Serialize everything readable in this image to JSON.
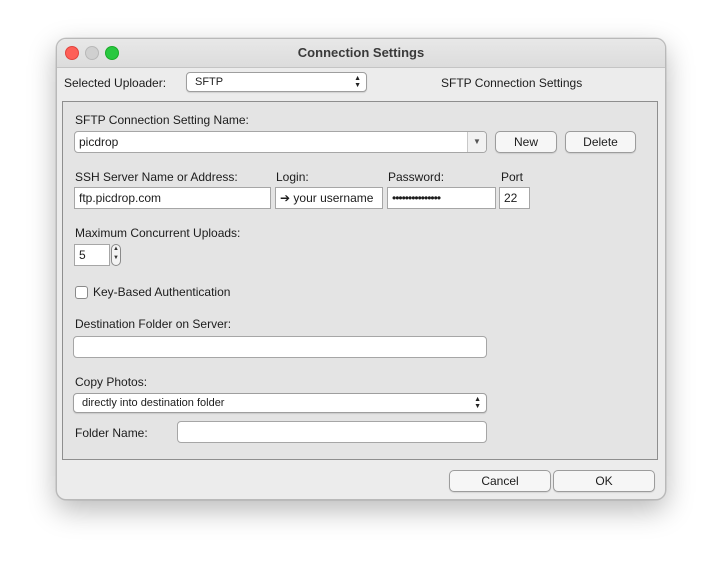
{
  "window": {
    "title": "Connection Settings"
  },
  "header": {
    "selected_uploader_label": "Selected Uploader:",
    "selected_uploader_value": "SFTP",
    "panel_title": "SFTP Connection Settings"
  },
  "connection": {
    "name_label": "SFTP Connection Setting Name:",
    "name_value": "picdrop",
    "new_label": "New",
    "delete_label": "Delete"
  },
  "server": {
    "server_label": "SSH Server Name or Address:",
    "server_value": "ftp.picdrop.com",
    "login_label": "Login:",
    "login_value": "➔ your username",
    "password_label": "Password:",
    "password_value": "•••••••••••••••",
    "port_label": "Port",
    "port_value": "22"
  },
  "uploads": {
    "max_label": "Maximum Concurrent Uploads:",
    "max_value": "5"
  },
  "auth": {
    "key_based_label": "Key-Based Authentication",
    "key_based_checked": false
  },
  "destination": {
    "folder_label": "Destination Folder on Server:",
    "folder_value": ""
  },
  "copy": {
    "copy_label": "Copy Photos:",
    "copy_value": "directly into destination folder",
    "folder_name_label": "Folder Name:",
    "folder_name_value": ""
  },
  "footer": {
    "cancel_label": "Cancel",
    "ok_label": "OK"
  }
}
